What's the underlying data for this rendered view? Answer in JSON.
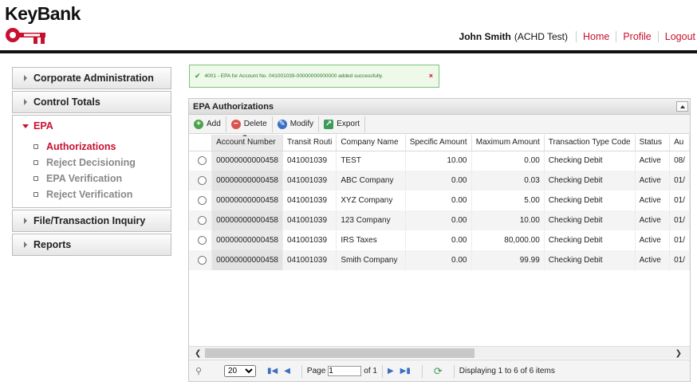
{
  "brand": {
    "name": "KeyBank",
    "brand_color": "#c8102e"
  },
  "header": {
    "user_name": "John Smith",
    "user_role": "(ACHD Test)",
    "links": [
      "Home",
      "Profile",
      "Logout"
    ]
  },
  "sidebar": {
    "items": [
      {
        "label": "Corporate Administration"
      },
      {
        "label": "Control Totals"
      },
      {
        "label": "EPA",
        "expanded": true,
        "sub_items": [
          "Authorizations",
          "Reject Decisioning",
          "EPA Verification",
          "Reject Verification"
        ],
        "active_sub": "Authorizations"
      },
      {
        "label": "File/Transaction Inquiry"
      },
      {
        "label": "Reports"
      }
    ]
  },
  "message": {
    "text": "4001 - EPA for Account No. 041001039-00000000000000 added successfully.",
    "close": "×"
  },
  "grid": {
    "title": "EPA Authorizations",
    "toolbar": [
      "Add",
      "Delete",
      "Modify",
      "Export"
    ],
    "columns": [
      "Account Number",
      "Transit Routi",
      "Company Name",
      "Specific Amount",
      "Maximum Amount",
      "Transaction Type Code",
      "Status",
      "Au"
    ],
    "rows": [
      [
        "00000000000458",
        "041001039",
        "TEST",
        "10.00",
        "0.00",
        "Checking Debit",
        "Active",
        "08/"
      ],
      [
        "00000000000458",
        "041001039",
        "ABC Company",
        "0.00",
        "0.03",
        "Checking Debit",
        "Active",
        "01/"
      ],
      [
        "00000000000458",
        "041001039",
        "XYZ Company",
        "0.00",
        "5.00",
        "Checking Debit",
        "Active",
        "01/"
      ],
      [
        "00000000000458",
        "041001039",
        "123 Company",
        "0.00",
        "10.00",
        "Checking Debit",
        "Active",
        "01/"
      ],
      [
        "00000000000458",
        "041001039",
        "IRS Taxes",
        "0.00",
        "80,000.00",
        "Checking Debit",
        "Active",
        "01/"
      ],
      [
        "00000000000458",
        "041001039",
        "Smith Company",
        "0.00",
        "99.99",
        "Checking Debit",
        "Active",
        "01/"
      ]
    ]
  },
  "pager": {
    "page_size": "20",
    "page_label": "Page",
    "page_value": "1",
    "of_label": "of 1",
    "display_text": "Displaying 1 to 6 of 6 items"
  }
}
